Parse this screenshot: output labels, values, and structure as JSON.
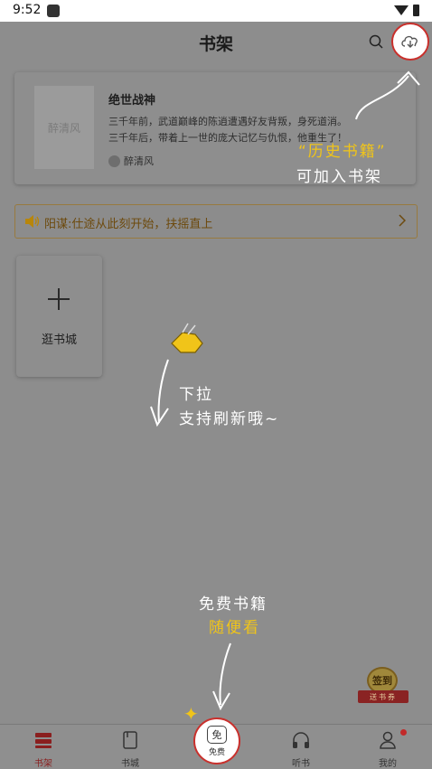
{
  "status_bar": {
    "time": "9:52"
  },
  "header": {
    "title": "书架",
    "search_icon": "search-icon",
    "cloud_icon": "cloud-download-icon"
  },
  "book": {
    "title": "绝世战神",
    "cover_text": "醉清风",
    "desc_line1": "三千年前，武道巅峰的陈逍遭遇好友背叛，身死道消。",
    "desc_line2": "三千年后，带着上一世的庞大记忆与仇恨，他重生了！",
    "author": "醉清风"
  },
  "notice": {
    "text": "阳谋:仕途从此刻开始，扶摇直上"
  },
  "add_tile": {
    "label": "逛书城"
  },
  "hints": {
    "history_line1": "“历史书籍”",
    "history_line2": "可加入书架",
    "pull_line1": "下拉",
    "pull_line2": "支持刷新哦~",
    "free_line1": "免费书籍",
    "free_line2": "随便看"
  },
  "signin": {
    "top": "签到",
    "ribbon": "送书券"
  },
  "tabs": [
    {
      "label": "书架",
      "icon": "bookshelf-icon"
    },
    {
      "label": "书城",
      "icon": "bookstore-icon"
    },
    {
      "label": "免费",
      "icon": "free-icon",
      "badge": "免"
    },
    {
      "label": "听书",
      "icon": "headphones-icon"
    },
    {
      "label": "我的",
      "icon": "profile-icon"
    }
  ],
  "colors": {
    "accent_red": "#c9302c",
    "hint_yellow": "#f0c419",
    "overlay": "#8d8d8d"
  }
}
